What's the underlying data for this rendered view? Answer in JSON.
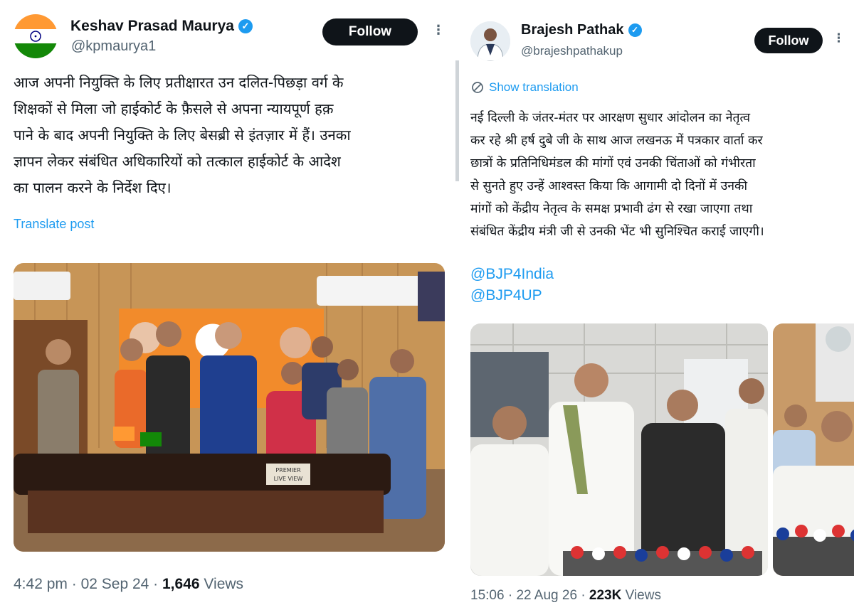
{
  "left_post": {
    "author_name": "Keshav Prasad Maurya",
    "handle": "@kpmaurya1",
    "follow_label": "Follow",
    "more_icon": "more-icon",
    "text": "आज अपनी नियुक्ति के लिए प्रतीक्षारत उन दलित-पिछड़ा वर्ग के\nशिक्षकों से मिला जो हाईकोर्ट के फ़ैसले से अपना न्यायपूर्ण हक़\nपाने के बाद अपनी नियुक्ति के लिए बेसब्री से इंतज़ार में हैं। उनका\nज्ञापन लेकर संबंधित अधिकारियों को तत्काल हाईकोर्ट के आदेश\nका पालन करने के निर्देश दिए।",
    "translate_label": "Translate post",
    "photo_sign_text": "PREMIER\nLIVE VIEW",
    "time": "4:42 pm",
    "date": "02 Sep 24",
    "views_count": "1,646",
    "views_label": "Views"
  },
  "right_post": {
    "author_name": "Brajesh Pathak",
    "handle": "@brajeshpathakup",
    "follow_label": "Follow",
    "translation_label": "Show translation",
    "text": "नई दिल्ली के जंतर-मंतर पर आरक्षण सुधार आंदोलन का नेतृत्व\nकर रहे श्री हर्ष दुबे जी के साथ आज लखनऊ में पत्रकार वार्ता कर\nछात्रों के प्रतिनिधिमंडल की मांगों एवं उनकी चिंताओं को गंभीरता\nसे सुनते हुए उन्हें आश्वस्त किया कि आगामी दो दिनों में उनकी\nमांगों को केंद्रीय नेतृत्व के समक्ष प्रभावी ढंग से रखा जाएगा तथा\nसंबंधित केंद्रीय मंत्री जी से उनकी भेंट भी सुनिश्चित कराई जाएगी।",
    "mentions": [
      "@BJP4India",
      "@BJP4UP"
    ],
    "time": "15:06",
    "date": "22 Aug 26",
    "views_count": "223K",
    "views_label": "Views"
  },
  "colors": {
    "link_blue": "#1d9bf0",
    "muted_gray": "#536471",
    "follow_bg": "#0f1419",
    "text": "#0f1419"
  }
}
